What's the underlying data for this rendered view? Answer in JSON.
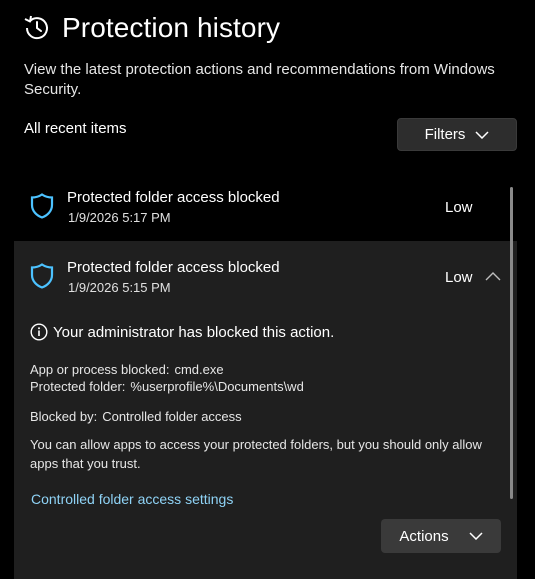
{
  "header": {
    "title": "Protection history",
    "subtitle": "View the latest protection actions and recommendations from Windows Security."
  },
  "toolbar": {
    "recent_label": "All recent items",
    "filters_label": "Filters"
  },
  "items": [
    {
      "title": "Protected folder access blocked",
      "date": "1/9/2026 5:17 PM",
      "severity": "Low",
      "expanded": false
    },
    {
      "title": "Protected folder access blocked",
      "date": "1/9/2026 5:15 PM",
      "severity": "Low",
      "expanded": true,
      "details": {
        "admin_message": "Your administrator has blocked this action.",
        "app_label": "App or process blocked:",
        "app_value": "cmd.exe",
        "folder_label": "Protected folder:",
        "folder_value": "%userprofile%\\Documents\\wd",
        "blocked_by_label": "Blocked by:",
        "blocked_by_value": "Controlled folder access",
        "description": "You can allow apps to access your protected folders, but you should only allow apps that you trust.",
        "settings_link": "Controlled folder access settings",
        "actions_label": "Actions"
      }
    }
  ],
  "colors": {
    "accent_shield": "#4cc2ff",
    "link": "#8fd3f6",
    "expanded_bg": "#1f1f1f"
  }
}
